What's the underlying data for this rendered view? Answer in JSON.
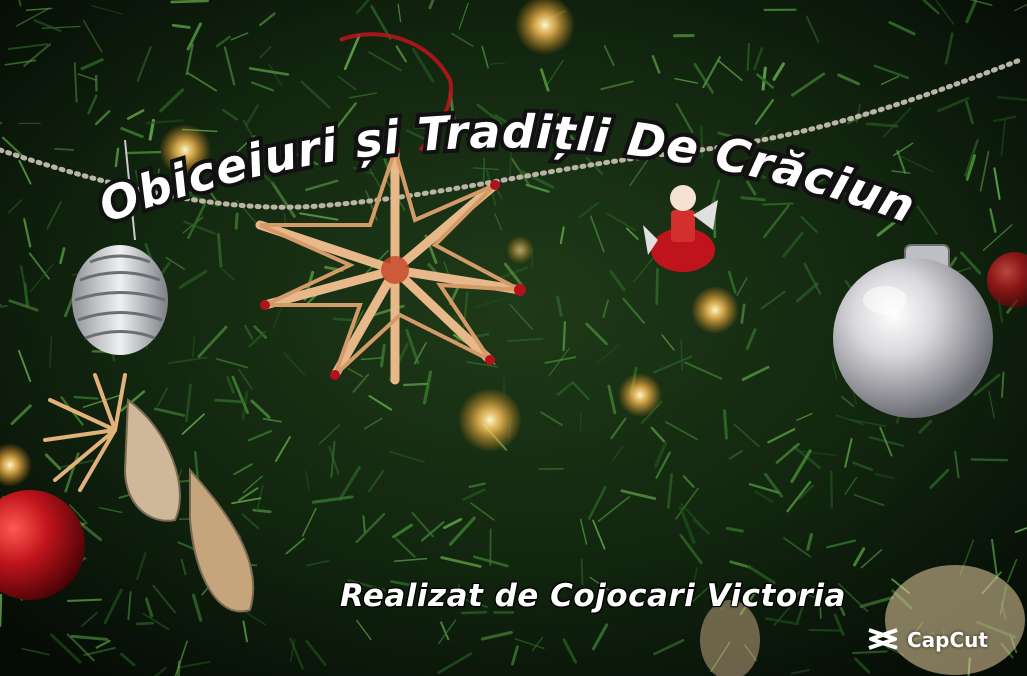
{
  "title": "Obiceiuri și Tradițli De Crăciun",
  "credit": "Realizat de Cojocari Victoria",
  "watermark": {
    "brand": "CapCut",
    "icon": "capcut-logo-icon"
  },
  "colors": {
    "pine_dark": "#0b1a0c",
    "pine_green": "#2f6a2a",
    "straw": "#e7b98a",
    "ornament_red": "#b3121a",
    "ornament_silver": "#c9c9cc",
    "title_fill": "#ffffff",
    "title_outline": "#111111"
  }
}
